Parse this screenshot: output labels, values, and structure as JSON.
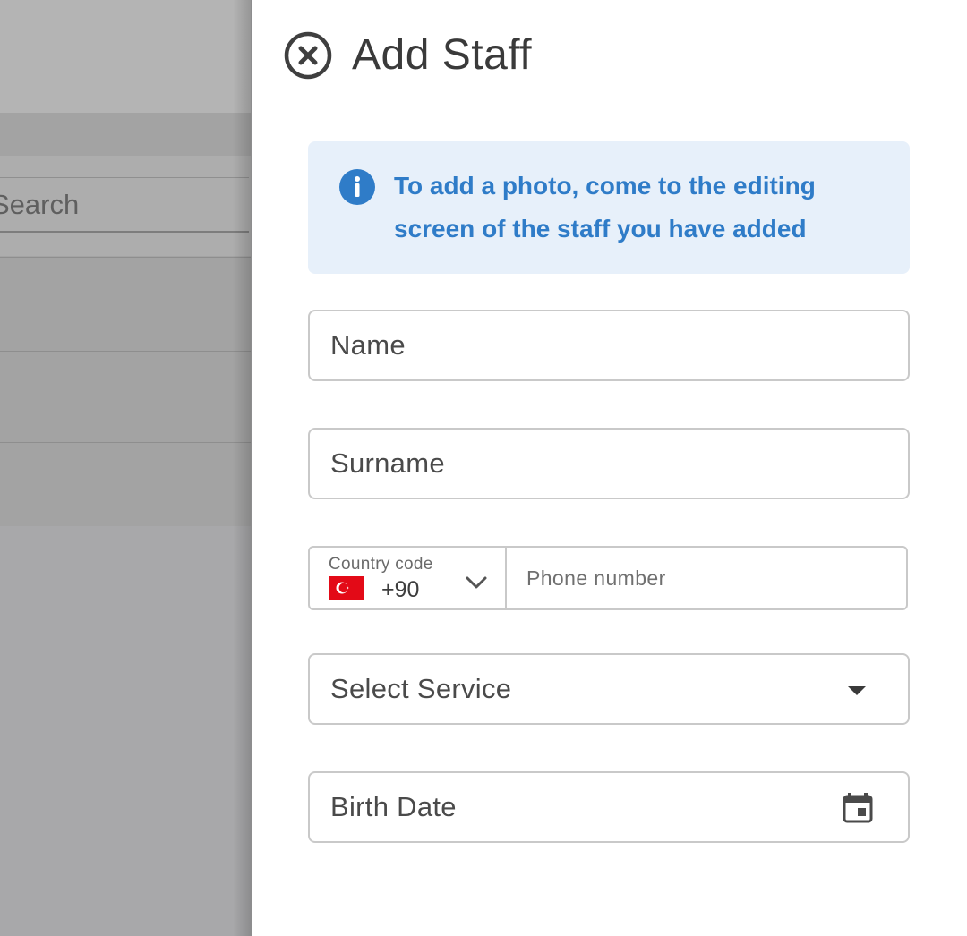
{
  "background": {
    "search_placeholder": "Search"
  },
  "drawer": {
    "title": "Add Staff",
    "info_message": "To add a photo, come to the editing screen of the staff you have added",
    "fields": {
      "name_placeholder": "Name",
      "surname_placeholder": "Surname",
      "country_code_label": "Country code",
      "country_code_value": "+90",
      "phone_placeholder": "Phone number",
      "service_placeholder": "Select Service",
      "birth_date_placeholder": "Birth Date"
    }
  },
  "colors": {
    "accent": "#2f7cc8",
    "info_bg": "#e7f0fa",
    "overlay": "#a9a9ab",
    "flag_red": "#e30a17"
  },
  "icons": {
    "close": "close-circle-icon",
    "info": "info-icon",
    "chevron": "chevron-down-icon",
    "dropdown": "caret-down-icon",
    "calendar": "calendar-icon",
    "flag": "turkey-flag-icon"
  }
}
